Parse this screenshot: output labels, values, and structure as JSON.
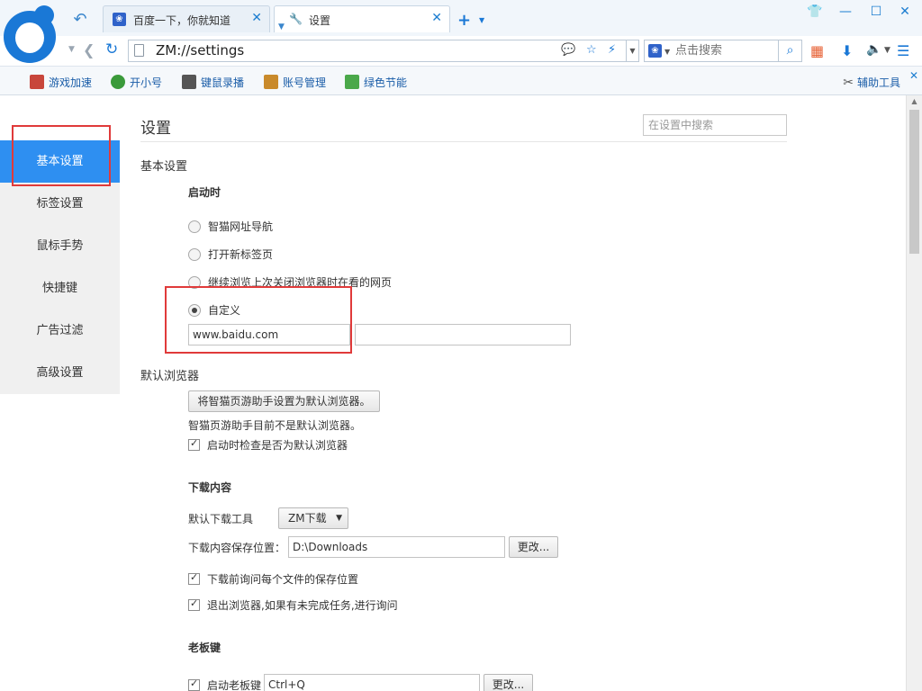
{
  "browser": {
    "tabs": [
      {
        "title": "百度一下，你就知道",
        "icon": "baidu-paw-icon"
      },
      {
        "title": "设置",
        "icon": "wrench-icon"
      }
    ],
    "address": "ZM://settings",
    "search_placeholder": "点击搜索",
    "bookmarks": [
      {
        "label": "游戏加速",
        "color": "#c8463b"
      },
      {
        "label": "开小号",
        "color": "#3a9a3a"
      },
      {
        "label": "键鼠录播",
        "color": "#555555"
      },
      {
        "label": "账号管理",
        "color": "#c98a2b"
      },
      {
        "label": "绿色节能",
        "color": "#4aa84a"
      }
    ],
    "tools_label": "辅助工具"
  },
  "sidebar": {
    "items": [
      {
        "label": "基本设置",
        "active": true
      },
      {
        "label": "标签设置"
      },
      {
        "label": "鼠标手势"
      },
      {
        "label": "快捷键"
      },
      {
        "label": "广告过滤"
      },
      {
        "label": "高级设置"
      }
    ]
  },
  "settings": {
    "page_title": "设置",
    "search_placeholder": "在设置中搜索",
    "basic_title": "基本设置",
    "startup": {
      "title": "启动时",
      "options": [
        "智猫网址导航",
        "打开新标签页",
        "继续浏览上次关闭浏览器时在看的网页",
        "自定义"
      ],
      "selected": 3,
      "custom_url": "www.baidu.com",
      "custom_url2": ""
    },
    "default_browser": {
      "title": "默认浏览器",
      "button": "将智猫页游助手设置为默认浏览器。",
      "status": "智猫页游助手目前不是默认浏览器。",
      "check_label": "启动时检查是否为默认浏览器"
    },
    "downloads": {
      "title": "下载内容",
      "tool_label": "默认下载工具",
      "tool_value": "ZM下载",
      "path_label": "下载内容保存位置：",
      "path_value": "D:\\Downloads",
      "change_label": "更改...",
      "ask_label": "下载前询问每个文件的保存位置",
      "exit_label": "退出浏览器,如果有未完成任务,进行询问"
    },
    "boss_key": {
      "title": "老板键",
      "enable_label": "启动老板键",
      "key_value": "Ctrl+Q",
      "change_label": "更改..."
    }
  }
}
